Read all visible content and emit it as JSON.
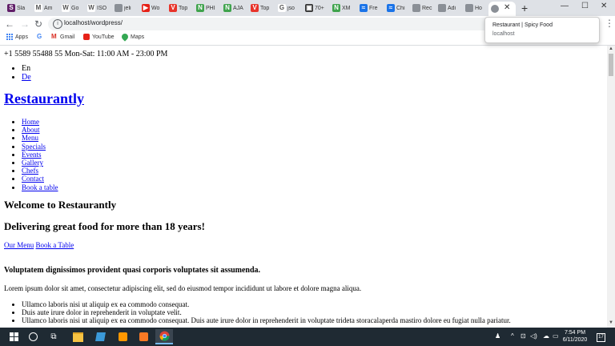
{
  "browser": {
    "tabs": [
      {
        "title": "Sla",
        "color": "#611f69",
        "letter": "S"
      },
      {
        "title": "Am",
        "color": "#ffffff",
        "letter": "M"
      },
      {
        "title": "Go",
        "color": "#ffffff",
        "letter": "W"
      },
      {
        "title": "ISO",
        "color": "#ffffff",
        "letter": "W"
      },
      {
        "title": "jeli",
        "color": "#8a8f96",
        "letter": ""
      },
      {
        "title": "Wo",
        "color": "#e62117",
        "letter": "▶"
      },
      {
        "title": "Top",
        "color": "#e8332a",
        "letter": "V"
      },
      {
        "title": "PHI",
        "color": "#3fa34d",
        "letter": "N"
      },
      {
        "title": "AJA",
        "color": "#3fa34d",
        "letter": "N"
      },
      {
        "title": "Top",
        "color": "#e8332a",
        "letter": "V"
      },
      {
        "title": "jso",
        "color": "#ffffff",
        "letter": "G"
      },
      {
        "title": "70+",
        "color": "#333333",
        "letter": "▣"
      },
      {
        "title": "XM",
        "color": "#3fa34d",
        "letter": "N"
      },
      {
        "title": "Fre",
        "color": "#1a73e8",
        "letter": "≈"
      },
      {
        "title": "Chi",
        "color": "#1a73e8",
        "letter": "≈"
      },
      {
        "title": "Rec",
        "color": "#8a8f96",
        "letter": ""
      },
      {
        "title": "Adi",
        "color": "#8a8f96",
        "letter": ""
      },
      {
        "title": "Ho",
        "color": "#8a8f96",
        "letter": ""
      }
    ],
    "active_tab_title": "",
    "new_tab_label": "+",
    "url": "localhost/wordpress/",
    "tooltip": {
      "title": "Restaurant | Spicy Food",
      "host": "localhost"
    },
    "bookmarks": [
      {
        "label": "Apps",
        "icon": "apps-grid-icon"
      },
      {
        "label": "",
        "icon": "google-icon"
      },
      {
        "label": "Gmail",
        "icon": "gmail-icon"
      },
      {
        "label": "YouTube",
        "icon": "youtube-icon"
      },
      {
        "label": "Maps",
        "icon": "maps-pin-icon"
      }
    ]
  },
  "site": {
    "contact": "+1 5589 55488 55 Mon-Sat: 11:00 AM - 23:00 PM",
    "languages": [
      "En",
      "De"
    ],
    "brand": "Restaurantly",
    "nav": [
      "Home",
      "About",
      "Menu",
      "Specials",
      "Events",
      "Gallery",
      "Chefs",
      "Contact",
      "Book a table"
    ],
    "welcome": "Welcome to Restaurantly",
    "tagline": "Delivering great food for more than 18 years!",
    "cta_menu": "Our Menu",
    "cta_book": "Book a Table",
    "about_heading": "Voluptatem dignissimos provident quasi corporis voluptates sit assumenda.",
    "about_text": "Lorem ipsum dolor sit amet, consectetur adipiscing elit, sed do eiusmod tempor incididunt ut labore et dolore magna aliqua.",
    "about_list": [
      "Ullamco laboris nisi ut aliquip ex ea commodo consequat.",
      "Duis aute irure dolor in reprehenderit in voluptate velit.",
      "Ullamco laboris nisi ut aliquip ex ea commodo consequat. Duis aute irure dolor in reprehenderit in voluptate trideta storacalaperda mastiro dolore eu fugiat nulla pariatur."
    ]
  },
  "taskbar": {
    "time": "7:54 PM",
    "date": "6/11/2020",
    "notification_count": "17"
  }
}
